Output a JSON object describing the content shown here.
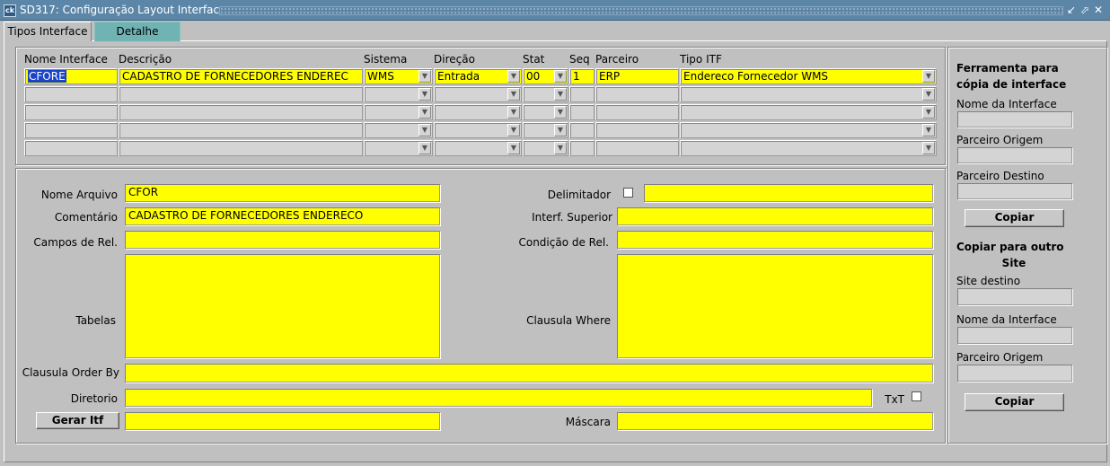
{
  "window": {
    "app_icon": "ck",
    "title": "SD317: Configuração Layout Interfaces",
    "controls": [
      "↙",
      "⬀",
      "✕"
    ]
  },
  "tabs": [
    {
      "label": "Tipos Interface",
      "active": true
    },
    {
      "label": "Detalhe",
      "active": false
    }
  ],
  "grid": {
    "headers": {
      "nome_interface": "Nome Interface",
      "descricao": "Descrição",
      "sistema": "Sistema",
      "direcao": "Direção",
      "stat": "Stat",
      "seq": "Seq",
      "parceiro": "Parceiro",
      "tipo_itf": "Tipo ITF"
    },
    "row1": {
      "nome_interface": "CFORE",
      "descricao": "CADASTRO DE FORNECEDORES ENDEREC",
      "sistema": "WMS",
      "direcao": "Entrada",
      "stat": "00",
      "seq": "1",
      "parceiro": "ERP",
      "tipo_itf": "Endereco Fornecedor WMS"
    },
    "empty_rows": 4
  },
  "detail": {
    "nome_arquivo_label": "Nome Arquivo",
    "nome_arquivo_value": "CFOR",
    "comentario_label": "Comentário",
    "comentario_value": "CADASTRO DE FORNECEDORES ENDERECO",
    "campos_rel_label": "Campos de Rel.",
    "campos_rel_value": "",
    "tabelas_label": "Tabelas",
    "tabelas_value": "",
    "clausula_order_label": "Clausula Order By",
    "clausula_order_value": "",
    "diretorio_label": "Diretorio",
    "diretorio_value": "",
    "gerar_itf_button": "Gerar Itf",
    "gerar_itf_value": "",
    "delimitador_label": "Delimitador",
    "delimitador_value": "",
    "interf_superior_label": "Interf. Superior",
    "interf_superior_value": "",
    "condicao_rel_label": "Condição de Rel.",
    "condicao_rel_value": "",
    "clausula_where_label": "Clausula Where",
    "clausula_where_value": "",
    "txt_label": "TxT",
    "mascara_label": "Máscara",
    "mascara_value": ""
  },
  "tools": {
    "copy_title_line1": "Ferramenta para",
    "copy_title_line2": "cópia de interface",
    "nome_interface_label": "Nome da Interface",
    "parceiro_origem_label": "Parceiro Origem",
    "parceiro_destino_label": "Parceiro Destino",
    "copiar_button": "Copiar",
    "site_title_line1": "Copiar para outro",
    "site_title_line2": "Site",
    "site_destino_label": "Site destino",
    "nome_interface2_label": "Nome da Interface",
    "parceiro_origem2_label": "Parceiro Origem",
    "copiar2_button": "Copiar"
  }
}
